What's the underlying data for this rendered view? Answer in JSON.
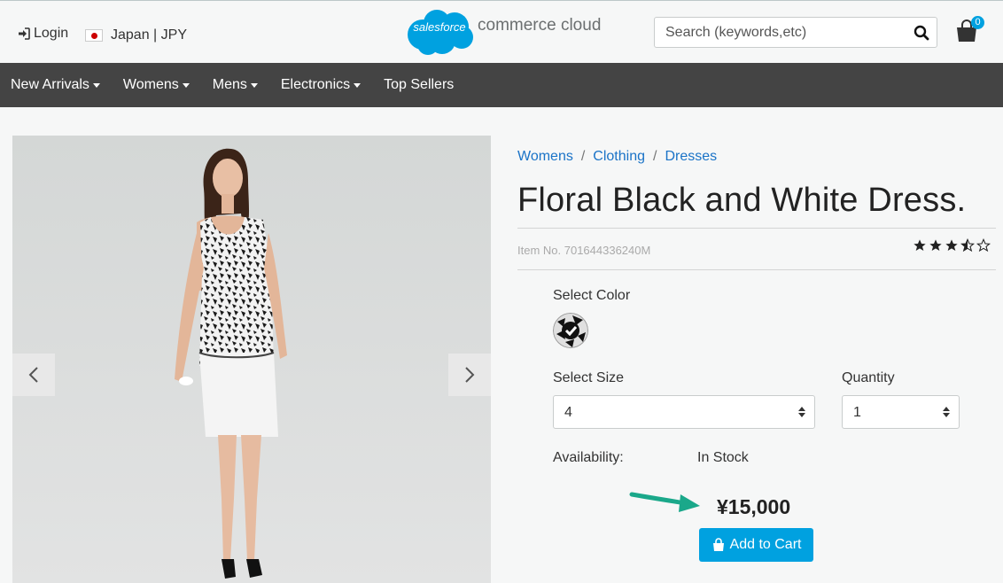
{
  "header": {
    "login_label": "Login",
    "locale_label": "Japan | JPY",
    "logo_cloud_text": "salesforce",
    "logo_text": "commerce cloud",
    "search_placeholder": "Search (keywords,etc)",
    "cart_count": "0"
  },
  "nav": {
    "items": [
      "New Arrivals",
      "Womens",
      "Mens",
      "Electronics",
      "Top Sellers"
    ]
  },
  "breadcrumb": [
    "Womens",
    "Clothing",
    "Dresses"
  ],
  "breadcrumb_separator": "/",
  "product": {
    "title": "Floral Black and White Dress.",
    "item_no": "Item No. 701644336240M",
    "rating_stars": 3.5,
    "select_color_label": "Select Color",
    "select_size_label": "Select Size",
    "size_value": "4",
    "quantity_label": "Quantity",
    "quantity_value": "1",
    "availability_label": "Availability:",
    "availability_value": "In Stock",
    "price": "¥15,000",
    "add_to_cart_label": "Add to Cart"
  },
  "colors": {
    "accent": "#00a1e0",
    "nav_bg": "#444444",
    "link": "#1a73c7",
    "arrow": "#1aa88a"
  }
}
